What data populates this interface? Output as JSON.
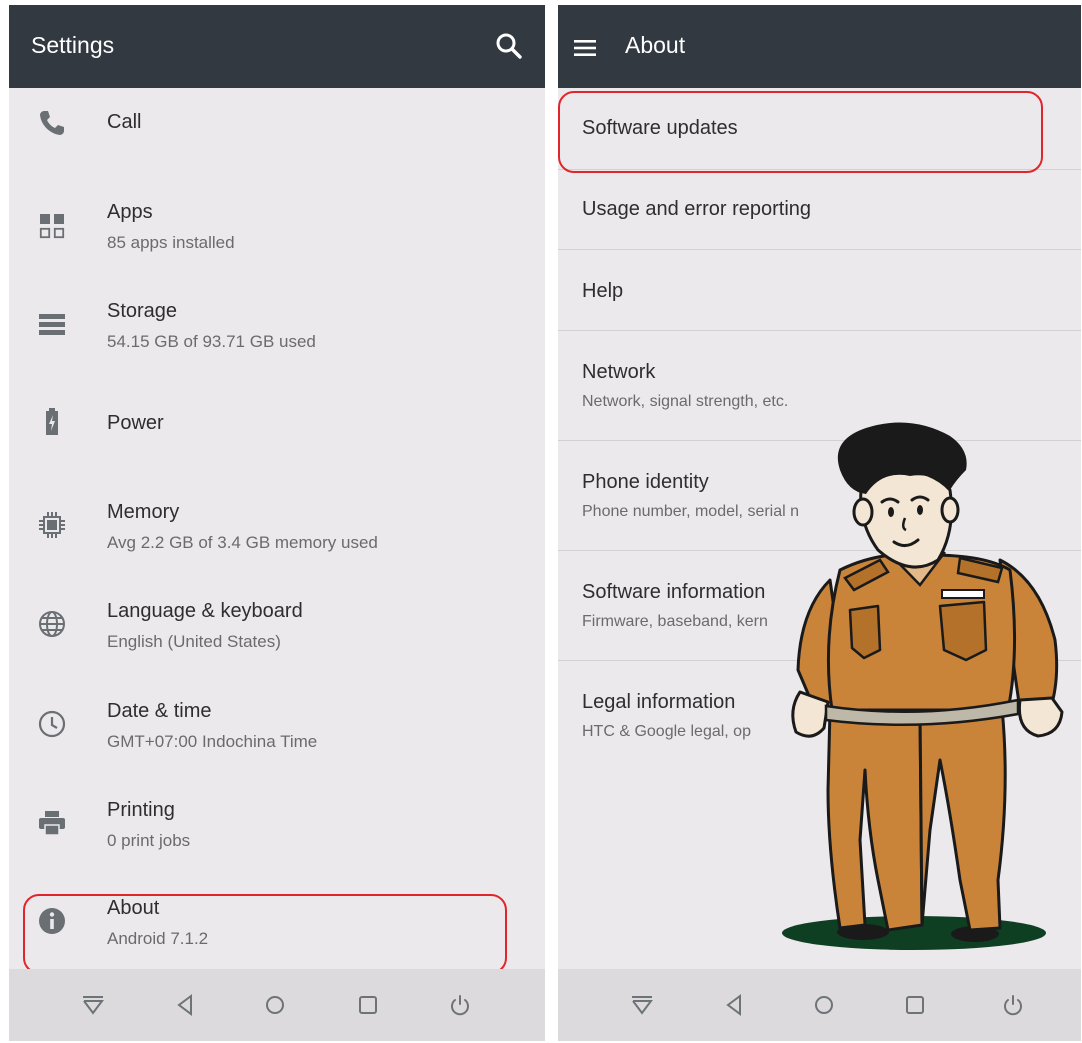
{
  "left": {
    "title": "Settings",
    "search_icon": "search-icon",
    "items": [
      {
        "title": "Call",
        "subtitle": "",
        "icon": "phone-icon"
      },
      {
        "title": "Apps",
        "subtitle": "85 apps installed",
        "icon": "apps-grid-icon"
      },
      {
        "title": "Storage",
        "subtitle": "54.15 GB of 93.71 GB used",
        "icon": "storage-icon"
      },
      {
        "title": "Power",
        "subtitle": "",
        "icon": "battery-icon"
      },
      {
        "title": "Memory",
        "subtitle": "Avg 2.2 GB of 3.4 GB memory used",
        "icon": "memory-chip-icon"
      },
      {
        "title": "Language & keyboard",
        "subtitle": "English (United States)",
        "icon": "globe-icon"
      },
      {
        "title": "Date & time",
        "subtitle": "GMT+07:00 Indochina Time",
        "icon": "clock-icon"
      },
      {
        "title": "Printing",
        "subtitle": "0 print jobs",
        "icon": "printer-icon"
      },
      {
        "title": "About",
        "subtitle": "Android 7.1.2",
        "icon": "info-icon"
      }
    ]
  },
  "right": {
    "title": "About",
    "menu_icon": "hamburger-menu-icon",
    "items": [
      {
        "title": "Software updates",
        "subtitle": ""
      },
      {
        "title": "Usage and error reporting",
        "subtitle": ""
      },
      {
        "title": "Help",
        "subtitle": ""
      },
      {
        "title": "Network",
        "subtitle": "Network, signal strength, etc."
      },
      {
        "title": "Phone identity",
        "subtitle": "Phone number, model, serial n"
      },
      {
        "title": "Software information",
        "subtitle": "Firmware, baseband, kern"
      },
      {
        "title": "Legal information",
        "subtitle": "HTC & Google legal, op"
      }
    ]
  },
  "navbar": {
    "buttons": [
      "notifications-down-icon",
      "back-icon",
      "home-icon",
      "recents-icon",
      "power-icon"
    ]
  },
  "colors": {
    "appbar": "#323940",
    "background": "#ebe9ec",
    "navbar": "#dcdadd",
    "highlight": "#e0262b",
    "uniform": "#c9843a"
  }
}
